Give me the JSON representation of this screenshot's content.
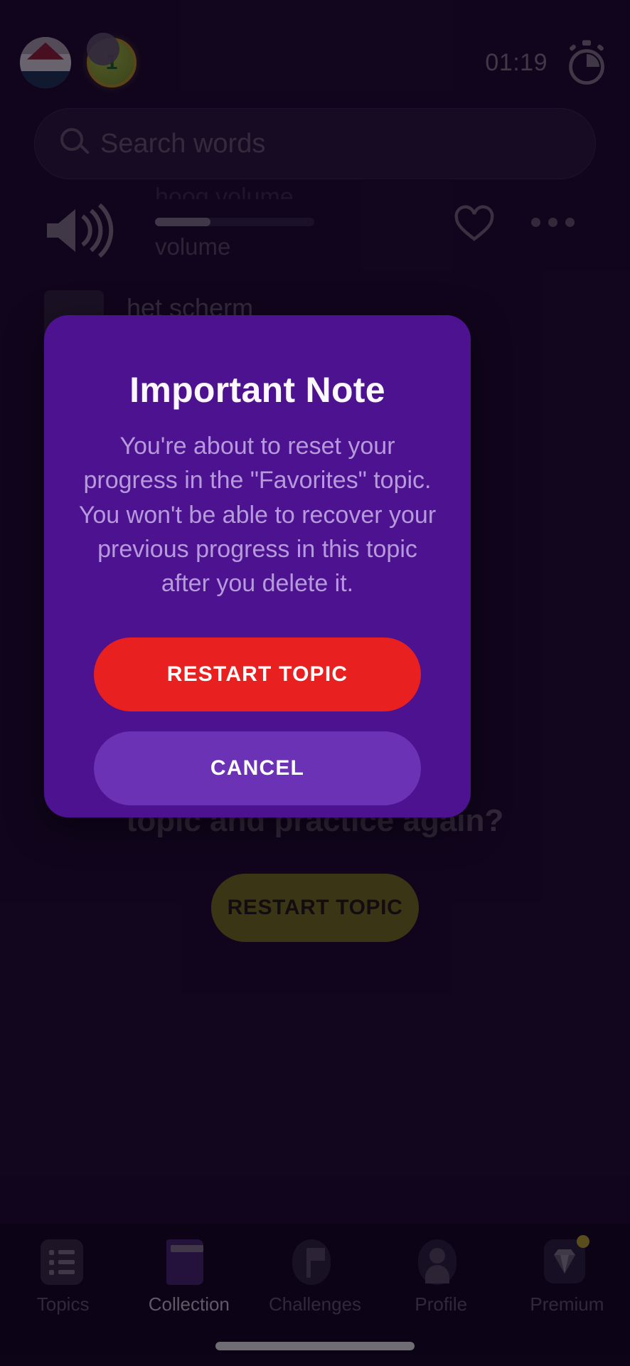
{
  "statusbar": {
    "language_flag_icon": "dutch-flag-icon",
    "coin_icon": "coin-icon",
    "coin_count": "1",
    "timer": "01:19",
    "stopwatch_icon": "stopwatch-icon"
  },
  "search": {
    "placeholder": "Search words",
    "value": "",
    "icon": "search-icon"
  },
  "word_row": {
    "speaker_icon": "speaker-volume-icon",
    "clipped_label": "hoog volume",
    "volume_label": "volume",
    "volume_percent": 35,
    "favorite_icon": "heart-outline-icon",
    "more_icon": "more-options-icon",
    "word": "het scherm"
  },
  "background": {
    "question": "topic and practice again?",
    "restart_label": "RESTART TOPIC"
  },
  "modal": {
    "title": "Important Note",
    "body": "You're about to reset your progress in the \"Favorites\" topic. You won't be able to recover your previous progress in this topic after you delete it.",
    "primary_label": "RESTART TOPIC",
    "secondary_label": "CANCEL",
    "background_color": "#4d128f",
    "primary_color": "#e8201f",
    "secondary_color": "#6b32b5"
  },
  "bottom_nav": {
    "items": [
      {
        "label": "Topics",
        "icon": "list-icon",
        "active": false
      },
      {
        "label": "Collection",
        "icon": "book-icon",
        "active": true
      },
      {
        "label": "Challenges",
        "icon": "flag-icon",
        "active": false
      },
      {
        "label": "Profile",
        "icon": "person-icon",
        "active": false
      },
      {
        "label": "Premium",
        "icon": "diamond-icon",
        "active": false
      }
    ]
  }
}
